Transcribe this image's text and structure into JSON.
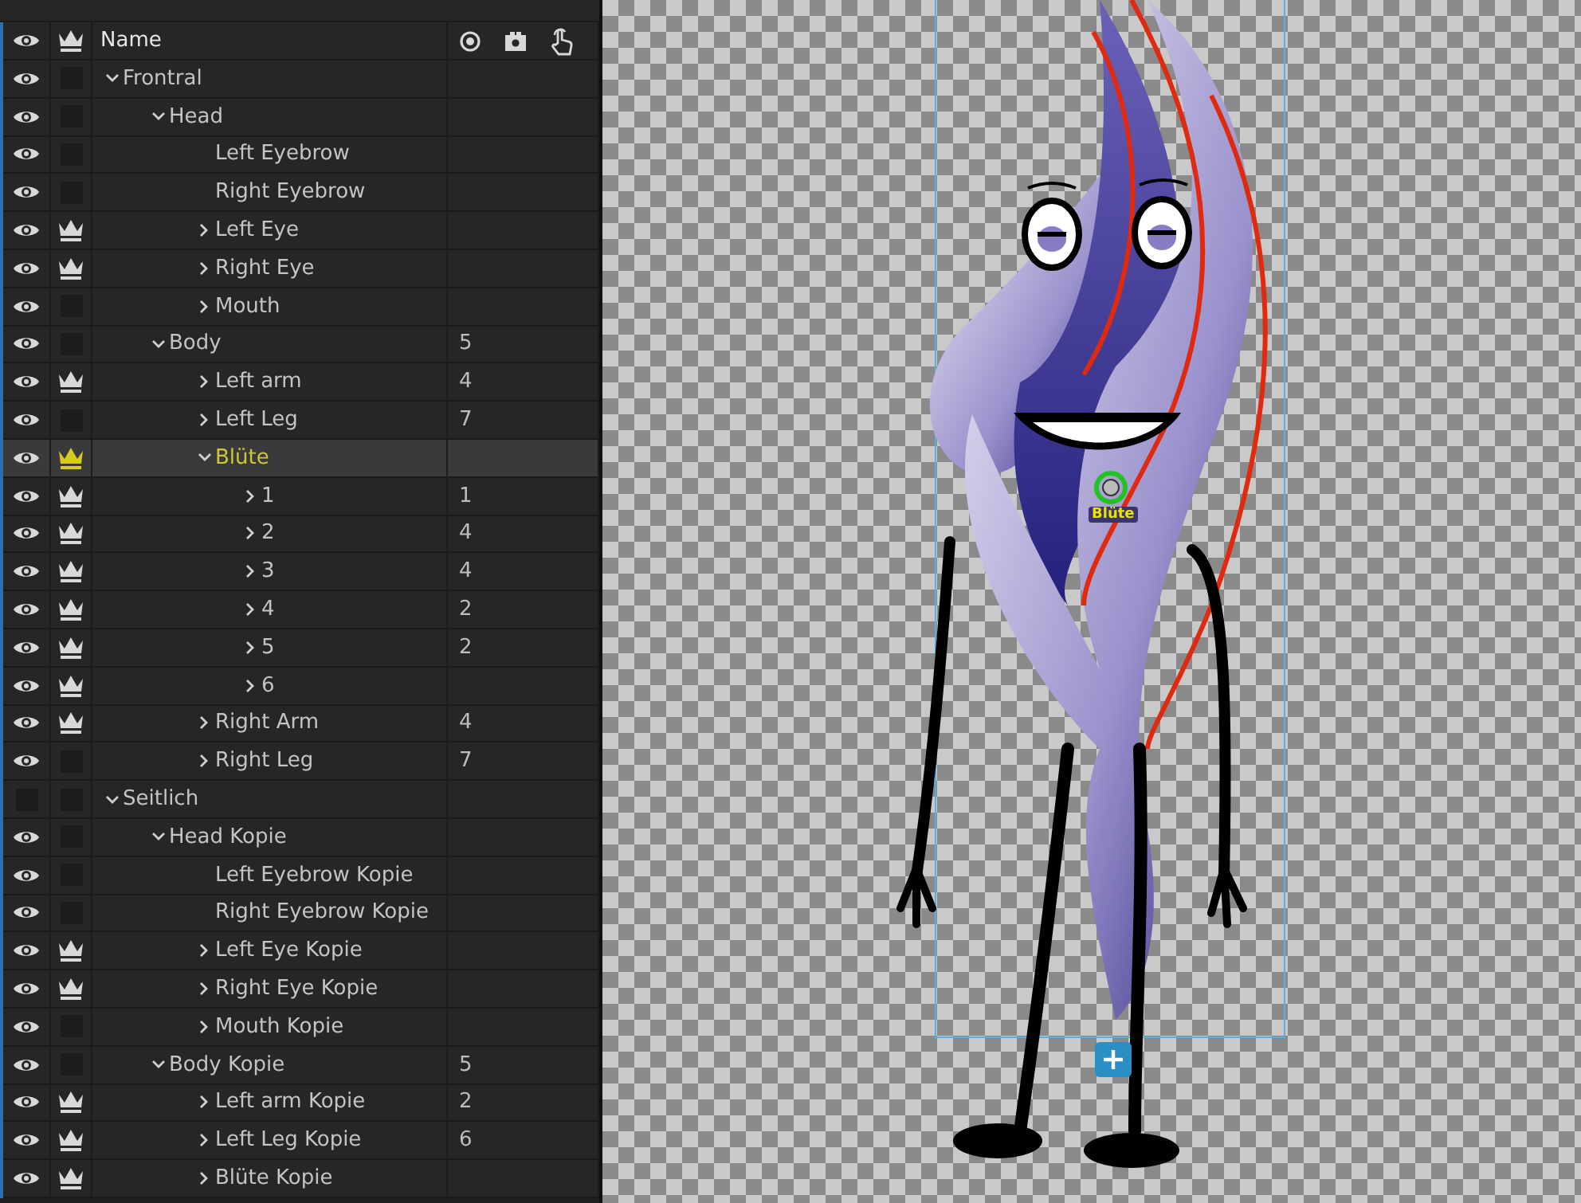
{
  "layers_panel": {
    "header": {
      "name_label": "Name"
    },
    "layers": [
      {
        "name": "Frontral",
        "visible": true,
        "handle": false,
        "kind": "group",
        "expanded": true,
        "selected": false,
        "children": [
          {
            "name": "Head",
            "visible": true,
            "handle": false,
            "kind": "group",
            "expanded": true,
            "selected": false,
            "children": [
              {
                "name": "Left Eyebrow",
                "visible": true,
                "handle": false,
                "kind": "leaf",
                "selected": false
              },
              {
                "name": "Right Eyebrow",
                "visible": true,
                "handle": false,
                "kind": "leaf",
                "selected": false
              },
              {
                "name": "Left Eye",
                "visible": true,
                "handle": true,
                "kind": "group",
                "expanded": false,
                "selected": false
              },
              {
                "name": "Right Eye",
                "visible": true,
                "handle": true,
                "kind": "group",
                "expanded": false,
                "selected": false
              },
              {
                "name": "Mouth",
                "visible": true,
                "handle": false,
                "kind": "group",
                "expanded": false,
                "selected": false
              }
            ]
          },
          {
            "name": "Body",
            "count": "5",
            "visible": true,
            "handle": false,
            "kind": "group",
            "expanded": true,
            "selected": false,
            "children": [
              {
                "name": "Left arm",
                "count": "4",
                "visible": true,
                "handle": true,
                "kind": "group",
                "expanded": false,
                "selected": false
              },
              {
                "name": "Left Leg",
                "count": "7",
                "visible": true,
                "handle": false,
                "kind": "group",
                "expanded": false,
                "selected": false
              },
              {
                "name": "Blüte",
                "visible": true,
                "handle": true,
                "kind": "group",
                "expanded": true,
                "selected": true,
                "children": [
                  {
                    "name": "1",
                    "count": "1",
                    "visible": true,
                    "handle": true,
                    "kind": "group",
                    "expanded": false,
                    "selected": false
                  },
                  {
                    "name": "2",
                    "count": "4",
                    "visible": true,
                    "handle": true,
                    "kind": "group",
                    "expanded": false,
                    "selected": false
                  },
                  {
                    "name": "3",
                    "count": "4",
                    "visible": true,
                    "handle": true,
                    "kind": "group",
                    "expanded": false,
                    "selected": false
                  },
                  {
                    "name": "4",
                    "count": "2",
                    "visible": true,
                    "handle": true,
                    "kind": "group",
                    "expanded": false,
                    "selected": false
                  },
                  {
                    "name": "5",
                    "count": "2",
                    "visible": true,
                    "handle": true,
                    "kind": "group",
                    "expanded": false,
                    "selected": false
                  },
                  {
                    "name": "6",
                    "visible": true,
                    "handle": true,
                    "kind": "group",
                    "expanded": false,
                    "selected": false
                  }
                ]
              },
              {
                "name": "Right Arm",
                "count": "4",
                "visible": true,
                "handle": true,
                "kind": "group",
                "expanded": false,
                "selected": false
              },
              {
                "name": "Right Leg",
                "count": "7",
                "visible": true,
                "handle": false,
                "kind": "group",
                "expanded": false,
                "selected": false
              }
            ]
          }
        ]
      },
      {
        "name": "Seitlich",
        "visible": false,
        "handle": false,
        "kind": "group",
        "expanded": true,
        "selected": false,
        "children": [
          {
            "name": "Head Kopie",
            "visible": true,
            "handle": false,
            "kind": "group",
            "expanded": true,
            "selected": false,
            "children": [
              {
                "name": "Left Eyebrow Kopie",
                "visible": true,
                "handle": false,
                "kind": "leaf",
                "selected": false
              },
              {
                "name": "Right Eyebrow Kopie",
                "visible": true,
                "handle": false,
                "kind": "leaf",
                "selected": false
              },
              {
                "name": "Left Eye Kopie",
                "visible": true,
                "handle": true,
                "kind": "group",
                "expanded": false,
                "selected": false
              },
              {
                "name": "Right Eye Kopie",
                "visible": true,
                "handle": true,
                "kind": "group",
                "expanded": false,
                "selected": false
              },
              {
                "name": "Mouth Kopie",
                "visible": true,
                "handle": false,
                "kind": "group",
                "expanded": false,
                "selected": false
              }
            ]
          },
          {
            "name": "Body Kopie",
            "count": "5",
            "visible": true,
            "handle": false,
            "kind": "group",
            "expanded": true,
            "selected": false,
            "children": [
              {
                "name": "Left arm Kopie",
                "count": "2",
                "visible": true,
                "handle": true,
                "kind": "group",
                "expanded": false,
                "selected": false
              },
              {
                "name": "Left Leg Kopie",
                "count": "6",
                "visible": true,
                "handle": true,
                "kind": "group",
                "expanded": false,
                "selected": false
              },
              {
                "name": "Blüte Kopie",
                "visible": true,
                "handle": true,
                "kind": "group",
                "expanded": false,
                "selected": false
              }
            ]
          }
        ]
      }
    ]
  },
  "canvas": {
    "handle_label": "Blüte"
  }
}
